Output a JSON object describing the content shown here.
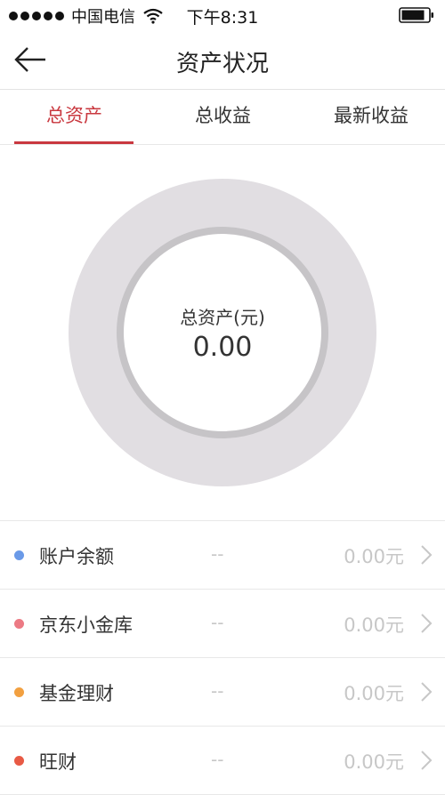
{
  "status_bar": {
    "carrier": "中国电信",
    "time": "下午8:31",
    "icons": [
      "signal-dots-icon",
      "wifi-icon",
      "battery-icon"
    ]
  },
  "header": {
    "title": "资产状况",
    "back_icon": "back-arrow-icon"
  },
  "tabs": [
    {
      "label": "总资产",
      "active": true
    },
    {
      "label": "总收益",
      "active": false
    },
    {
      "label": "最新收益",
      "active": false
    }
  ],
  "summary": {
    "label": "总资产(元)",
    "value": "0.00"
  },
  "chart_data": {
    "type": "pie",
    "categories": [
      "账户余额",
      "京东小金库",
      "基金理财",
      "旺财"
    ],
    "values": [
      0,
      0,
      0,
      0
    ],
    "title": "",
    "xlabel": "",
    "ylabel": "",
    "colors": {
      "ring": "#e1dee2",
      "inner_ring": "#c6c4c7"
    }
  },
  "assets": [
    {
      "name": "账户余额",
      "percent": "--",
      "amount": "0.00元",
      "color": "#6a9ae8"
    },
    {
      "name": "京东小金库",
      "percent": "--",
      "amount": "0.00元",
      "color": "#ec7a84"
    },
    {
      "name": "基金理财",
      "percent": "--",
      "amount": "0.00元",
      "color": "#f2a040"
    },
    {
      "name": "旺财",
      "percent": "--",
      "amount": "0.00元",
      "color": "#e85a45"
    }
  ],
  "colors": {
    "accent": "#c9383f",
    "muted_text": "#c7c7c7",
    "divider": "#e8e8e8"
  }
}
